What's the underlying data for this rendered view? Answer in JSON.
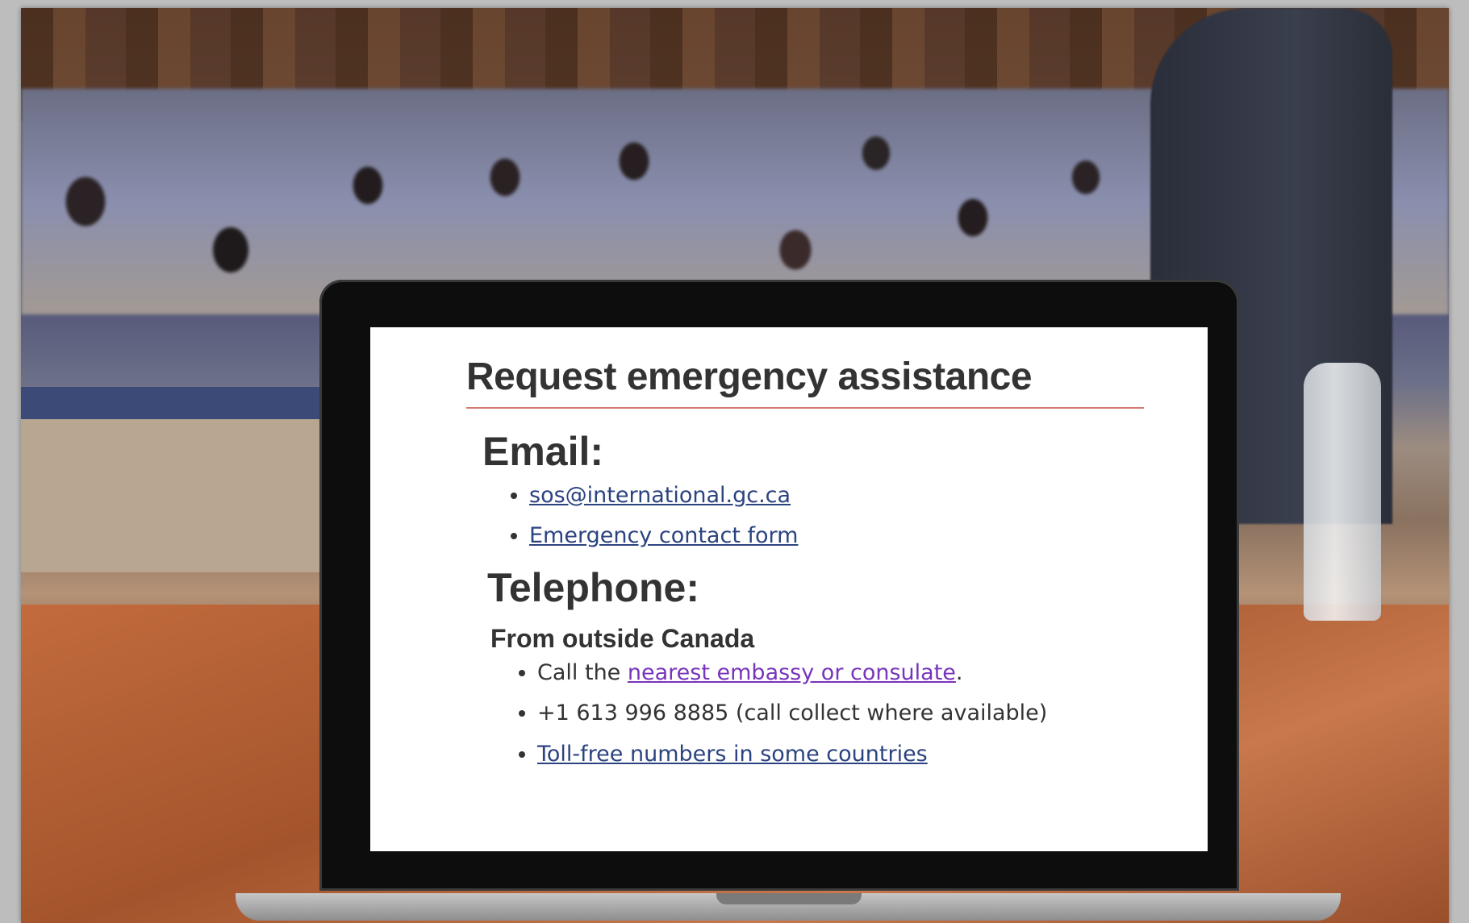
{
  "page": {
    "title": "Request emergency assistance",
    "email_heading": "Email:",
    "email_links": [
      "sos@international.gc.ca",
      "Emergency contact form"
    ],
    "telephone_heading": "Telephone:",
    "telephone_subheading": "From outside Canada",
    "telephone_items": {
      "item1_prefix": "Call the ",
      "item1_link": "nearest embassy or consulate",
      "item1_suffix": ".",
      "item2": "+1 613 996 8885 (call collect where available)",
      "item3_link": "Toll-free numbers in some countries"
    }
  },
  "colors": {
    "title_rule": "#d77a72",
    "link": "#2b4380",
    "visited_link": "#7834bc"
  }
}
